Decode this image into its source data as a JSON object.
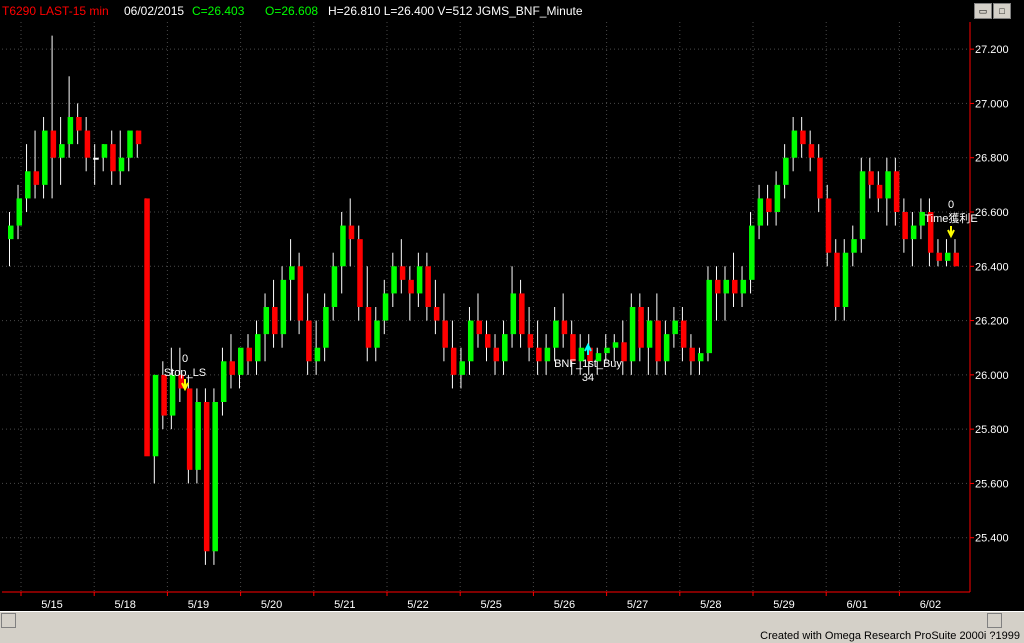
{
  "header": {
    "symbol": "T6290 LAST-15 min",
    "date": "06/02/2015",
    "close": "C=26.403",
    "open": "O=26.608",
    "hlv": "H=26.810  L=26.400  V=512  JGMS_BNF_Minute"
  },
  "window_buttons": {
    "restore": "▭",
    "maximize": "□"
  },
  "status_bar": {
    "text": "Created with Omega Research ProSuite 2000i ?1999"
  },
  "colors": {
    "up": "#00ff00",
    "down": "#ff0000",
    "neutral": "#ffffff",
    "grid": "#4a4a4a",
    "axis": "#ff0000",
    "signal_buy": "#00ffff",
    "signal_sell": "#ffff00"
  },
  "chart_data": {
    "type": "bar",
    "title": "T6290 LAST-15 min",
    "y_axis": {
      "min": 25.2,
      "max": 27.3,
      "ticks": [
        "25.400",
        "25.600",
        "25.800",
        "26.000",
        "26.200",
        "26.400",
        "26.600",
        "26.800",
        "27.000",
        "27.200"
      ]
    },
    "x_axis": {
      "ticks": [
        "5/15",
        "5/18",
        "5/19",
        "5/20",
        "5/21",
        "5/22",
        "5/25",
        "5/26",
        "5/27",
        "5/28",
        "5/29",
        "6/01",
        "6/02"
      ]
    },
    "grid": true,
    "annotations": [
      {
        "label": "0",
        "text": "Stop_LS",
        "type": "sell"
      },
      {
        "label": "34",
        "text": "BNF_1st_Buy",
        "type": "buy"
      },
      {
        "label": "0",
        "text": "Time獲利E",
        "type": "sell"
      }
    ],
    "bars": [
      [
        26.5,
        26.6,
        26.4,
        26.55
      ],
      [
        26.55,
        26.7,
        26.5,
        26.65
      ],
      [
        26.65,
        26.85,
        26.6,
        26.75
      ],
      [
        26.75,
        26.9,
        26.65,
        26.7
      ],
      [
        26.7,
        26.95,
        26.65,
        26.9
      ],
      [
        26.9,
        27.25,
        26.65,
        26.8
      ],
      [
        26.8,
        26.95,
        26.7,
        26.85
      ],
      [
        26.85,
        27.1,
        26.8,
        26.95
      ],
      [
        26.95,
        27.0,
        26.85,
        26.9
      ],
      [
        26.9,
        26.95,
        26.75,
        26.8
      ],
      [
        26.8,
        26.85,
        26.7,
        26.8
      ],
      [
        26.8,
        26.85,
        26.75,
        26.85
      ],
      [
        26.85,
        26.9,
        26.7,
        26.75
      ],
      [
        26.75,
        26.9,
        26.7,
        26.8
      ],
      [
        26.8,
        26.9,
        26.75,
        26.9
      ],
      [
        26.9,
        26.9,
        26.8,
        26.85
      ],
      [
        26.65,
        26.65,
        25.9,
        25.7
      ],
      [
        25.7,
        26.0,
        25.6,
        26.0
      ],
      [
        26.0,
        26.05,
        25.8,
        25.85
      ],
      [
        25.85,
        26.1,
        25.8,
        26.0
      ],
      [
        26.0,
        26.1,
        25.9,
        25.95
      ],
      [
        25.95,
        26.0,
        25.6,
        25.65
      ],
      [
        25.65,
        25.95,
        25.6,
        25.9
      ],
      [
        25.9,
        25.95,
        25.3,
        25.35
      ],
      [
        25.35,
        25.95,
        25.3,
        25.9
      ],
      [
        25.9,
        26.1,
        25.85,
        26.05
      ],
      [
        26.05,
        26.15,
        25.95,
        26.0
      ],
      [
        26.0,
        26.1,
        25.95,
        26.1
      ],
      [
        26.1,
        26.15,
        26.0,
        26.05
      ],
      [
        26.05,
        26.2,
        26.0,
        26.15
      ],
      [
        26.15,
        26.3,
        26.05,
        26.25
      ],
      [
        26.25,
        26.35,
        26.1,
        26.15
      ],
      [
        26.15,
        26.4,
        26.1,
        26.35
      ],
      [
        26.35,
        26.5,
        26.2,
        26.4
      ],
      [
        26.4,
        26.45,
        26.15,
        26.2
      ],
      [
        26.2,
        26.3,
        26.0,
        26.05
      ],
      [
        26.05,
        26.2,
        26.0,
        26.1
      ],
      [
        26.1,
        26.3,
        26.05,
        26.25
      ],
      [
        26.25,
        26.45,
        26.2,
        26.4
      ],
      [
        26.4,
        26.6,
        26.3,
        26.55
      ],
      [
        26.55,
        26.65,
        26.4,
        26.5
      ],
      [
        26.5,
        26.55,
        26.2,
        26.25
      ],
      [
        26.25,
        26.4,
        26.05,
        26.1
      ],
      [
        26.1,
        26.25,
        26.05,
        26.2
      ],
      [
        26.2,
        26.35,
        26.15,
        26.3
      ],
      [
        26.3,
        26.45,
        26.25,
        26.4
      ],
      [
        26.4,
        26.5,
        26.3,
        26.35
      ],
      [
        26.35,
        26.4,
        26.2,
        26.3
      ],
      [
        26.3,
        26.45,
        26.25,
        26.4
      ],
      [
        26.4,
        26.45,
        26.2,
        26.25
      ],
      [
        26.25,
        26.35,
        26.15,
        26.2
      ],
      [
        26.2,
        26.3,
        26.05,
        26.1
      ],
      [
        26.1,
        26.2,
        25.95,
        26.0
      ],
      [
        26.0,
        26.1,
        25.95,
        26.05
      ],
      [
        26.05,
        26.25,
        26.0,
        26.2
      ],
      [
        26.2,
        26.3,
        26.1,
        26.15
      ],
      [
        26.15,
        26.2,
        26.05,
        26.1
      ],
      [
        26.1,
        26.15,
        26.0,
        26.05
      ],
      [
        26.05,
        26.2,
        26.0,
        26.15
      ],
      [
        26.15,
        26.4,
        26.1,
        26.3
      ],
      [
        26.3,
        26.35,
        26.1,
        26.15
      ],
      [
        26.15,
        26.25,
        26.05,
        26.1
      ],
      [
        26.1,
        26.2,
        26.0,
        26.05
      ],
      [
        26.05,
        26.15,
        26.0,
        26.1
      ],
      [
        26.1,
        26.25,
        26.05,
        26.2
      ],
      [
        26.2,
        26.3,
        26.1,
        26.15
      ],
      [
        26.15,
        26.2,
        26.0,
        26.05
      ],
      [
        26.05,
        26.15,
        26.0,
        26.1
      ],
      [
        26.1,
        26.15,
        26.0,
        26.05
      ],
      [
        26.05,
        26.1,
        26.0,
        26.08
      ],
      [
        26.08,
        26.15,
        26.05,
        26.1
      ],
      [
        26.1,
        26.15,
        26.05,
        26.12
      ],
      [
        26.12,
        26.2,
        26.0,
        26.05
      ],
      [
        26.05,
        26.3,
        26.0,
        26.25
      ],
      [
        26.25,
        26.3,
        26.05,
        26.1
      ],
      [
        26.1,
        26.25,
        26.0,
        26.2
      ],
      [
        26.2,
        26.3,
        26.0,
        26.05
      ],
      [
        26.05,
        26.2,
        26.0,
        26.15
      ],
      [
        26.15,
        26.25,
        26.1,
        26.2
      ],
      [
        26.2,
        26.25,
        26.05,
        26.1
      ],
      [
        26.1,
        26.15,
        26.0,
        26.05
      ],
      [
        26.05,
        26.1,
        26.0,
        26.08
      ],
      [
        26.08,
        26.4,
        26.05,
        26.35
      ],
      [
        26.35,
        26.4,
        26.2,
        26.3
      ],
      [
        26.3,
        26.4,
        26.2,
        26.35
      ],
      [
        26.35,
        26.45,
        26.25,
        26.3
      ],
      [
        26.3,
        26.4,
        26.25,
        26.35
      ],
      [
        26.35,
        26.6,
        26.3,
        26.55
      ],
      [
        26.55,
        26.7,
        26.5,
        26.65
      ],
      [
        26.65,
        26.7,
        26.55,
        26.6
      ],
      [
        26.6,
        26.75,
        26.55,
        26.7
      ],
      [
        26.7,
        26.85,
        26.65,
        26.8
      ],
      [
        26.8,
        26.95,
        26.75,
        26.9
      ],
      [
        26.9,
        26.95,
        26.8,
        26.85
      ],
      [
        26.85,
        26.9,
        26.75,
        26.8
      ],
      [
        26.8,
        26.85,
        26.6,
        26.65
      ],
      [
        26.65,
        26.7,
        26.4,
        26.45
      ],
      [
        26.45,
        26.5,
        26.2,
        26.25
      ],
      [
        26.25,
        26.5,
        26.2,
        26.45
      ],
      [
        26.45,
        26.55,
        26.4,
        26.5
      ],
      [
        26.5,
        26.8,
        26.45,
        26.75
      ],
      [
        26.75,
        26.8,
        26.65,
        26.7
      ],
      [
        26.7,
        26.75,
        26.6,
        26.65
      ],
      [
        26.65,
        26.8,
        26.55,
        26.75
      ],
      [
        26.75,
        26.8,
        26.55,
        26.6
      ],
      [
        26.6,
        26.65,
        26.45,
        26.5
      ],
      [
        26.5,
        26.6,
        26.4,
        26.55
      ],
      [
        26.55,
        26.65,
        26.5,
        26.6
      ],
      [
        26.6,
        26.65,
        26.4,
        26.45
      ],
      [
        26.45,
        26.5,
        26.4,
        26.42
      ],
      [
        26.42,
        26.5,
        26.4,
        26.45
      ],
      [
        26.45,
        26.5,
        26.4,
        26.4
      ]
    ]
  }
}
